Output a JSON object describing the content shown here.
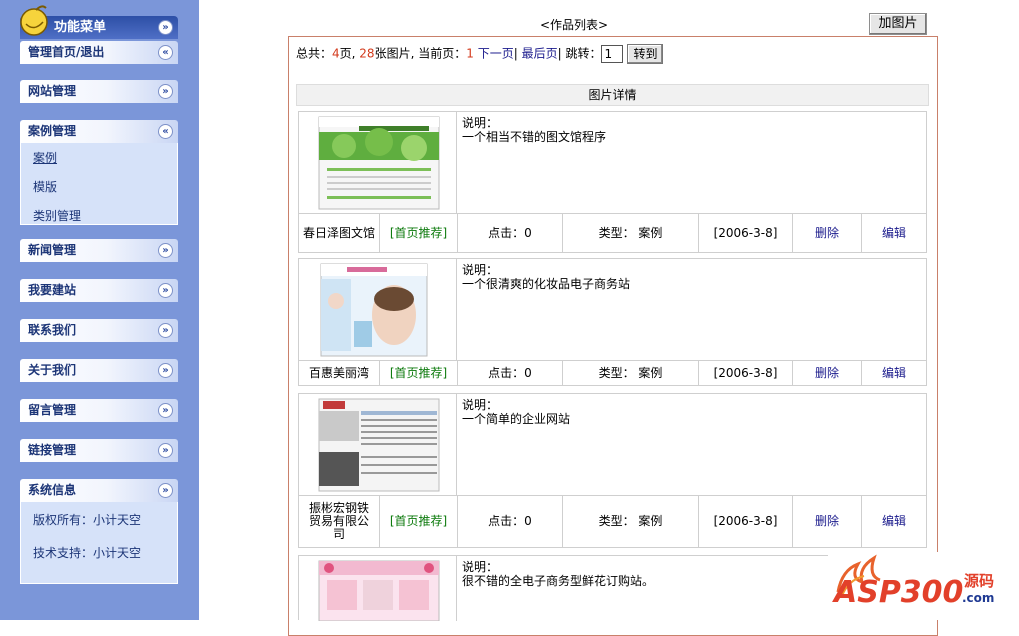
{
  "sidebar": {
    "title": "功能菜单",
    "sections": [
      {
        "label": "管理首页/退出",
        "toggle": "«"
      },
      {
        "label": "网站管理",
        "toggle": "»"
      },
      {
        "label": "案例管理",
        "toggle": "«",
        "items": [
          "案例",
          "模版",
          "类别管理"
        ]
      },
      {
        "label": "新闻管理",
        "toggle": "»"
      },
      {
        "label": "我要建站",
        "toggle": "»"
      },
      {
        "label": "联系我们",
        "toggle": "»"
      },
      {
        "label": "关于我们",
        "toggle": "»"
      },
      {
        "label": "留言管理",
        "toggle": "»"
      },
      {
        "label": "链接管理",
        "toggle": "»"
      },
      {
        "label": "系统信息",
        "toggle": "»",
        "items": [
          "版权所有：小计天空",
          "技术支持：小计天空"
        ]
      }
    ]
  },
  "main": {
    "heading": "<作品列表>",
    "add_button": "加图片",
    "pager": {
      "total_prefix": "总共：",
      "pages": "4",
      "pages_suffix": "页, ",
      "images": "28",
      "images_suffix": "张图片, 当前页：",
      "current": "1",
      "next": "下一页",
      "sep1": "|",
      "last": "最后页",
      "sep2": "|",
      "jump_label": "跳转：",
      "jump_value": "1",
      "go": "转到"
    },
    "detail_header": "图片详情",
    "items": [
      {
        "title": "春日泽图文馆",
        "recommend": "[首页推荐]",
        "clicks": "点击：0",
        "type": "类型：  案例",
        "date": "[2006-3-8]",
        "delete": "删除",
        "edit": "编辑",
        "desc_label": "说明：",
        "desc": "一个相当不错的图文馆程序"
      },
      {
        "title": "百惠美丽湾",
        "recommend": "[首页推荐]",
        "clicks": "点击：0",
        "type": "类型：  案例",
        "date": "[2006-3-8]",
        "delete": "删除",
        "edit": "编辑",
        "desc_label": "说明：",
        "desc": "一个很清爽的化妆品电子商务站"
      },
      {
        "title": "振彬宏钢铁贸易有限公司",
        "recommend": "[首页推荐]",
        "clicks": "点击：0",
        "type": "类型：  案例",
        "date": "[2006-3-8]",
        "delete": "删除",
        "edit": "编辑",
        "desc_label": "说明：",
        "desc": "一个简单的企业网站"
      },
      {
        "desc_label": "说明：",
        "desc": "很不错的全电子商务型鲜花订购站。"
      }
    ]
  },
  "watermark": {
    "brand": "ASP300",
    "suffix": "源码",
    "domain": ".com"
  }
}
